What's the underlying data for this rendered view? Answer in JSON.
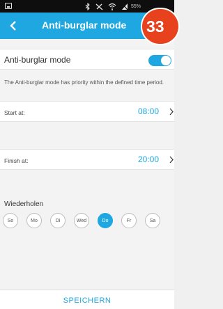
{
  "status_bar": {
    "battery": "55%",
    "icons": [
      "bluetooth-icon",
      "vibrate-icon",
      "wifi-icon",
      "signal-icon",
      "battery-icon"
    ]
  },
  "app_bar": {
    "title": "Anti-burglar mode",
    "back_icon": "back-arrow-icon",
    "color": "#1ea7e1"
  },
  "badge": {
    "label": "33",
    "color": "#e8411e"
  },
  "anti_burglar": {
    "label": "Anti-burglar mode",
    "enabled": true,
    "notice": "The Anti-burglar mode has priority within the defined time period."
  },
  "start": {
    "label": "Start at:",
    "value": "08:00"
  },
  "finish": {
    "label": "Finish at:",
    "value": "20:00"
  },
  "repeat": {
    "label": "Wiederholen",
    "days": [
      {
        "label": "So",
        "selected": false
      },
      {
        "label": "Mo",
        "selected": false
      },
      {
        "label": "Di",
        "selected": false
      },
      {
        "label": "Wed",
        "selected": false
      },
      {
        "label": "Do",
        "selected": true
      },
      {
        "label": "Fr",
        "selected": false
      },
      {
        "label": "Sa",
        "selected": false
      }
    ]
  },
  "footer": {
    "save_label": "SPEICHERN"
  }
}
